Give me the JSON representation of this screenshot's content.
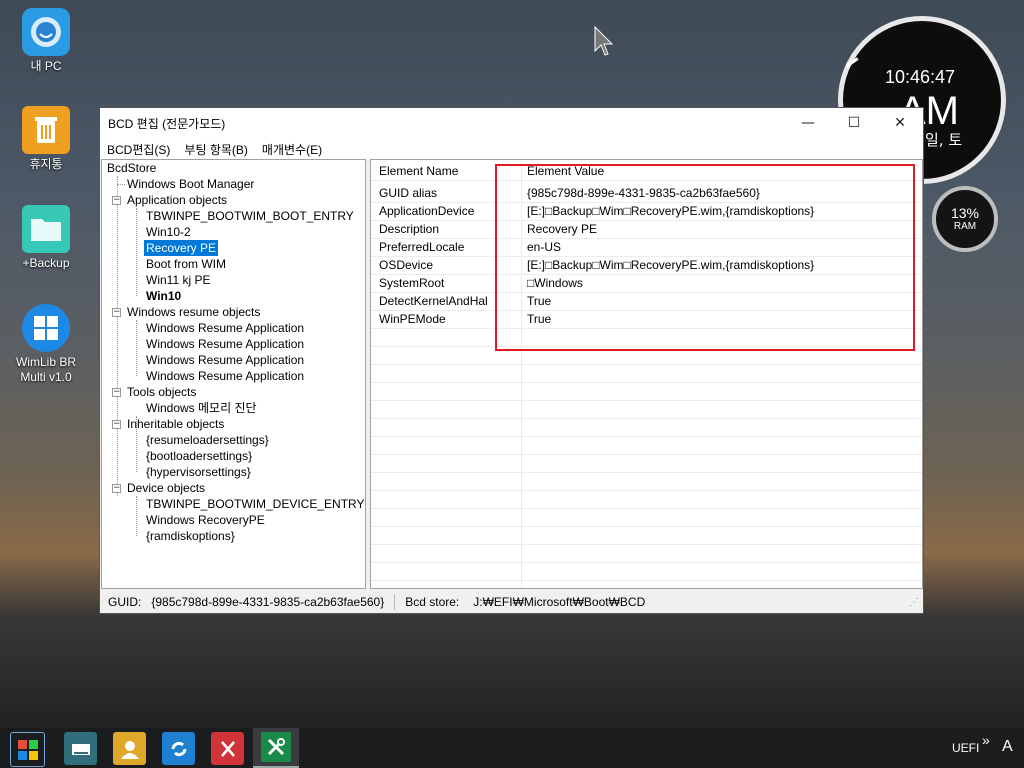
{
  "desktop": {
    "icons": [
      {
        "label": "내 PC",
        "icon": "my-pc-icon"
      },
      {
        "label": "휴지통",
        "icon": "recycle-bin-icon"
      },
      {
        "label": "+Backup",
        "icon": "folder-icon"
      },
      {
        "label": "WimLib BR\nMulti v1.0",
        "icon": "windows-logo-icon"
      }
    ]
  },
  "clock": {
    "time": "10:46:47",
    "ampm": "AM",
    "day": "일, 토"
  },
  "ram": {
    "percent": "13%",
    "label": "RAM",
    "level": 0.13
  },
  "window": {
    "title": "BCD 편집 (전문가모드)",
    "controls": {
      "minimize": "—",
      "maximize": "☐",
      "close": "✕"
    },
    "menu": [
      "BCD편집(S)",
      "부팅 항목(B)",
      "매개변수(E)"
    ],
    "tree": [
      {
        "text": "BcdStore"
      },
      {
        "text": "Windows Boot Manager"
      },
      {
        "text": "Application objects"
      },
      {
        "text": "TBWINPE_BOOTWIM_BOOT_ENTRY"
      },
      {
        "text": "Win10-2"
      },
      {
        "text": "Recovery PE",
        "selected": true
      },
      {
        "text": "Boot from WIM"
      },
      {
        "text": "Win11 kj PE"
      },
      {
        "text": "Win10",
        "bold": true
      },
      {
        "text": "Windows resume objects"
      },
      {
        "text": "Windows Resume Application"
      },
      {
        "text": "Windows Resume Application"
      },
      {
        "text": "Windows Resume Application"
      },
      {
        "text": "Windows Resume Application"
      },
      {
        "text": "Tools objects"
      },
      {
        "text": "Windows 메모리 진단"
      },
      {
        "text": "Inheritable objects"
      },
      {
        "text": "{resumeloadersettings}"
      },
      {
        "text": "{bootloadersettings}"
      },
      {
        "text": "{hypervisorsettings}"
      },
      {
        "text": "Device objects"
      },
      {
        "text": "TBWINPE_BOOTWIM_DEVICE_ENTRY"
      },
      {
        "text": "Windows RecoveryPE"
      },
      {
        "text": "{ramdiskoptions}"
      }
    ],
    "grid": {
      "headers": [
        "Element Name",
        "Element Value"
      ],
      "rows": [
        [
          "GUID alias",
          "{985c798d-899e-4331-9835-ca2b63fae560}"
        ],
        [
          "ApplicationDevice",
          "[E:]□Backup□Wim□RecoveryPE.wim,{ramdiskoptions}"
        ],
        [
          "Description",
          "Recovery PE"
        ],
        [
          "PreferredLocale",
          "en-US"
        ],
        [
          "OSDevice",
          "[E:]□Backup□Wim□RecoveryPE.wim,{ramdiskoptions}"
        ],
        [
          "SystemRoot",
          "□Windows"
        ],
        [
          "DetectKernelAndHal",
          "True"
        ],
        [
          "WinPEMode",
          "True"
        ]
      ]
    },
    "status": {
      "guid_label": "GUID:",
      "guid_value": "{985c798d-899e-4331-9835-ca2b63fae560}",
      "store_label": "Bcd store:",
      "store_value": "J:₩EFI₩Microsoft₩Boot₩BCD"
    }
  },
  "taskbar": {
    "items": [
      "start-icon",
      "drive-icon",
      "user-icon",
      "sync-icon",
      "x-app-icon",
      "tools-icon"
    ],
    "tray": {
      "uefi": "UEFI",
      "chevron": "»",
      "ime": "A"
    }
  }
}
